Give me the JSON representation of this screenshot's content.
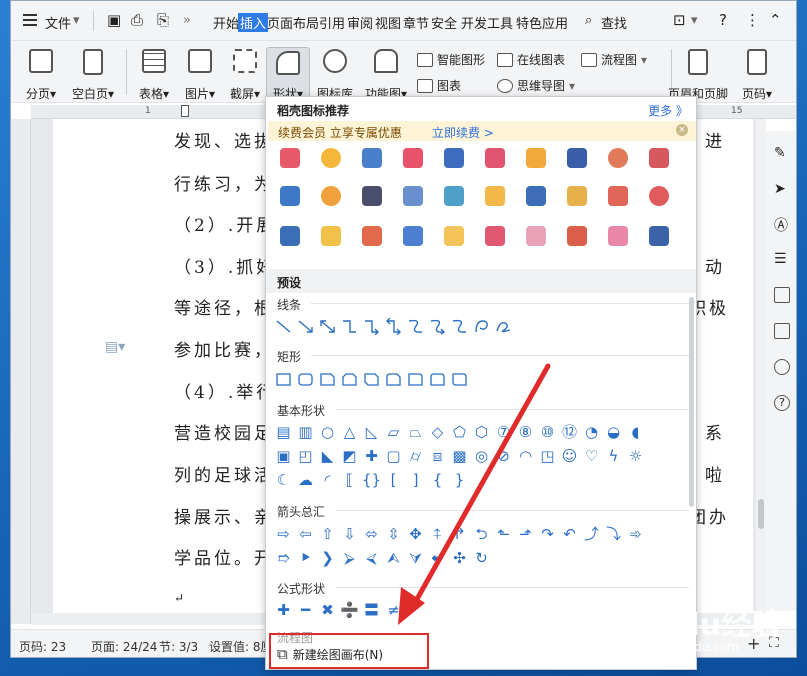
{
  "menu": {
    "file": "文件",
    "tabs": [
      "开始",
      "插入",
      "页面布局",
      "引用",
      "审阅",
      "视图",
      "章节",
      "安全",
      "开发工具",
      "特色应用"
    ],
    "active_tab": "插入",
    "search": "查找"
  },
  "ribbon": {
    "page_break": "分页",
    "blank_page": "空白页",
    "table": "表格",
    "picture": "图片",
    "screenshot": "截屏",
    "shapes": "形状",
    "icon_lib": "图标库",
    "func_chart": "功能图",
    "smart_art": "智能图形",
    "online_chart": "在线图表",
    "flowchart": "流程图",
    "chart": "图表",
    "mindmap": "思维导图",
    "header_footer": "页眉和页脚",
    "page_num": "页码"
  },
  "ruler": {
    "top_left": "1",
    "top_right": "15"
  },
  "document": {
    "lines": [
      "发现、选拔",
      "行练习，为",
      "（2）.开展",
      "（3）.抓好",
      "等途径，根",
      "参加比赛，",
      "（4）.举行",
      "营造校园足",
      "列的足球活",
      "操展示、亲",
      "学品位。开"
    ],
    "right_lines": [
      "进",
      "",
      "",
      "动",
      "积极",
      "",
      "",
      "系",
      "啦",
      "团办",
      ""
    ],
    "return_mark": "↵"
  },
  "status": {
    "page_num": "页码: 23",
    "page": "页面: 24/24",
    "section": "节: 3/3",
    "setting": "设置值: 8厘"
  },
  "dropdown": {
    "title": "稻壳图标推荐",
    "more": "更多 》",
    "vip": "续费会员 立享专属优惠",
    "renew": "立即续费 >",
    "close": "×",
    "preset": "预设",
    "categories": [
      "线条",
      "矩形",
      "基本形状",
      "箭头总汇",
      "公式形状",
      "流程图"
    ],
    "new_canvas": "新建绘图画布(N)"
  },
  "watermark": {
    "main": "Baidu经验",
    "sub": "jingyan.baidu.com"
  },
  "colors": {
    "accent": "#2e7be8",
    "highlight": "#e02b2b",
    "banner": "#fdf3d6",
    "shape": "#2b6fc4"
  }
}
